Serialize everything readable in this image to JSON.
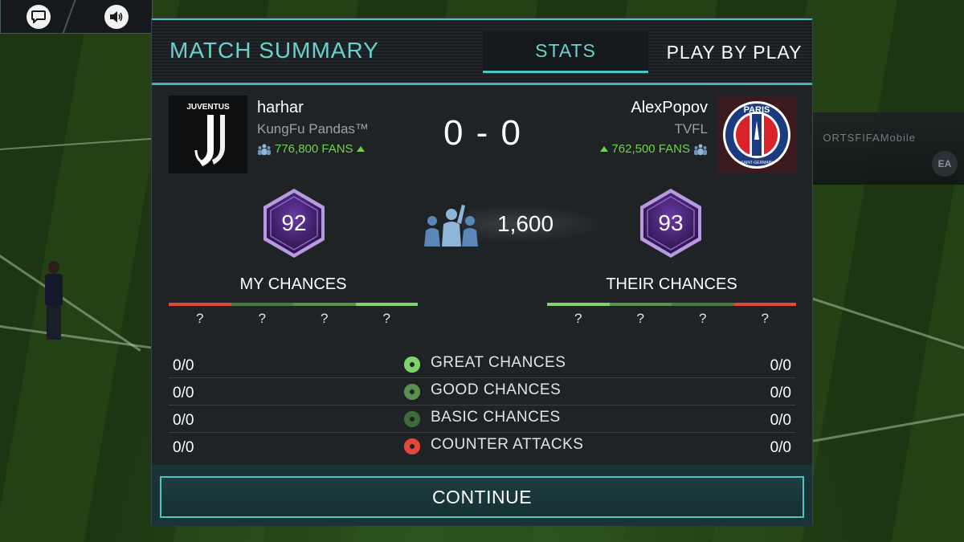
{
  "window": {
    "chat_icon": "chat-bubble-icon",
    "sound_icon": "speaker-icon",
    "background_ad": "ORTSFIFAMobile",
    "background_logo": "EA"
  },
  "header": {
    "title": "MATCH SUMMARY",
    "tabs": [
      {
        "label": "STATS",
        "active": true
      },
      {
        "label": "PLAY BY PLAY",
        "active": false
      }
    ]
  },
  "home": {
    "name": "harhar",
    "club": "KungFu Pandas™",
    "fans": "776,800 FANS",
    "rating": "92",
    "crest": "juventus-crest",
    "crest_text": "JUVENTUS"
  },
  "away": {
    "name": "AlexPopov",
    "club": "TVFL",
    "fans": "762,500 FANS",
    "rating": "93",
    "crest": "psg-crest",
    "crest_text_top": "PARIS",
    "crest_text_bottom": "SAINT-GERMAIN"
  },
  "score": "0 - 0",
  "attendance": "1,600",
  "chances": {
    "my_title": "MY CHANCES",
    "their_title": "THEIR CHANCES",
    "my_bar_colors": [
      "#e2483a",
      "#4a7a42",
      "#5a8f4e",
      "#7fd36a"
    ],
    "their_bar_colors": [
      "#7fd36a",
      "#5a8f4e",
      "#4a7a42",
      "#e2483a"
    ],
    "my_marks": [
      "?",
      "?",
      "?",
      "?"
    ],
    "their_marks": [
      "?",
      "?",
      "?",
      "?"
    ]
  },
  "stats": [
    {
      "label": "GREAT CHANCES",
      "home": "0/0",
      "away": "0/0",
      "icon": "great-ball-icon",
      "color": "#7fd36a"
    },
    {
      "label": "GOOD CHANCES",
      "home": "0/0",
      "away": "0/0",
      "icon": "good-ball-icon",
      "color": "#5a8f4e"
    },
    {
      "label": "BASIC CHANCES",
      "home": "0/0",
      "away": "0/0",
      "icon": "basic-ball-icon",
      "color": "#3f6a3a"
    },
    {
      "label": "COUNTER ATTACKS",
      "home": "0/0",
      "away": "0/0",
      "icon": "counter-ball-icon",
      "color": "#e2483a"
    }
  ],
  "continue_label": "CONTINUE",
  "colors": {
    "accent": "#48c5c1",
    "fans_green": "#6fd24a",
    "rating_purple": "#8a4fc9"
  }
}
